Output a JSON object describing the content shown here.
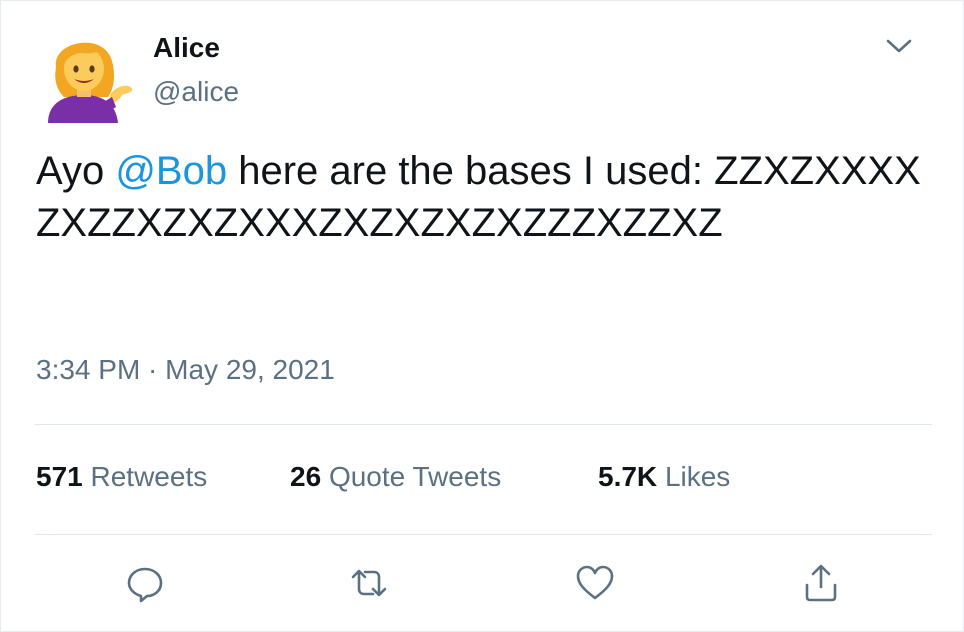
{
  "author": {
    "name": "Alice",
    "handle": "@alice",
    "avatar_icon": "woman-tipping-hand-emoji"
  },
  "tweet": {
    "text_before": "Ayo ",
    "mention": "@Bob",
    "text_after": " here are the bases I used: ZZXZXXXXZXZZXZXZXXXZXZXZXZXZZZXZZXZ",
    "timestamp": "3:34 PM · May 29, 2021"
  },
  "stats": {
    "retweets_count": "571",
    "retweets_label": "Retweets",
    "quote_tweets_count": "26",
    "quote_tweets_label": "Quote Tweets",
    "likes_count": "5.7K",
    "likes_label": "Likes"
  },
  "actions": {
    "reply_icon": "reply-icon",
    "retweet_icon": "retweet-icon",
    "like_icon": "heart-icon",
    "share_icon": "share-icon"
  },
  "colors": {
    "mention": "#1b95e0",
    "secondary_text": "#5b7083",
    "icon": "#5b7083",
    "divider": "#e1e8ed"
  }
}
